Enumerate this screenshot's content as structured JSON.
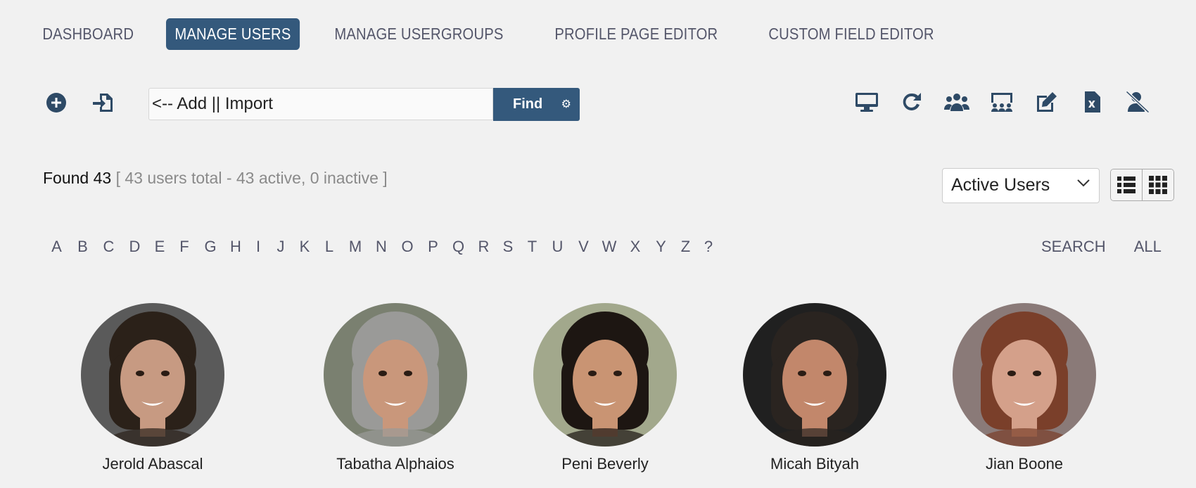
{
  "nav": {
    "tabs": [
      {
        "label": "DASHBOARD"
      },
      {
        "label": "MANAGE USERS",
        "active": true
      },
      {
        "label": "MANAGE USERGROUPS"
      },
      {
        "label": "PROFILE PAGE EDITOR"
      },
      {
        "label": "CUSTOM FIELD EDITOR"
      }
    ]
  },
  "toolbar": {
    "search_value": "<-- Add || Import",
    "find_label": "Find",
    "left_icons": [
      "add-user-icon",
      "import-icon"
    ],
    "right_icons": [
      "desktop-icon",
      "refresh-icon",
      "users-group-icon",
      "users-chalkboard-icon",
      "edit-icon",
      "excel-file-icon",
      "user-slash-icon"
    ]
  },
  "summary": {
    "found_label": "Found 43",
    "meta": "[ 43 users total - 43 active, 0 inactive ]"
  },
  "filter": {
    "selected": "Active Users"
  },
  "alphabet": [
    "A",
    "B",
    "C",
    "D",
    "E",
    "F",
    "G",
    "H",
    "I",
    "J",
    "K",
    "L",
    "M",
    "N",
    "O",
    "P",
    "Q",
    "R",
    "S",
    "T",
    "U",
    "V",
    "W",
    "X",
    "Y",
    "Z",
    "?"
  ],
  "alphabet_extra": [
    "SEARCH",
    "ALL"
  ],
  "users": [
    {
      "name": "Jerold Abascal",
      "bg": "#5a5a5a",
      "skin": "#c79a82",
      "hair": "#2b2119"
    },
    {
      "name": "Tabatha Alphaios",
      "bg": "#7a8070",
      "skin": "#c9977b",
      "hair": "#9a9a98"
    },
    {
      "name": "Peni Beverly",
      "bg": "#a2a88c",
      "skin": "#c99473",
      "hair": "#1d1612"
    },
    {
      "name": "Micah Bityah",
      "bg": "#202020",
      "skin": "#c2876b",
      "hair": "#2a2420"
    },
    {
      "name": "Jian Boone",
      "bg": "#8a7a78",
      "skin": "#d4a08a",
      "hair": "#7a3f2a"
    }
  ],
  "colors": {
    "accent": "#34597c",
    "icon": "#2e4a66",
    "tab_text": "#54566a",
    "background": "#f1f1f1"
  }
}
